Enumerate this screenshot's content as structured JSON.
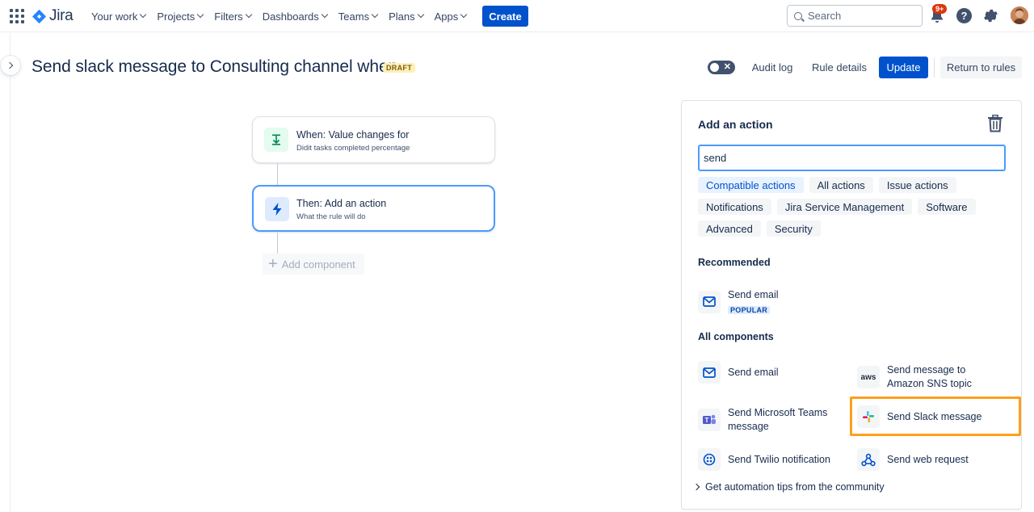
{
  "topnav": {
    "logo": "Jira",
    "items": [
      "Your work",
      "Projects",
      "Filters",
      "Dashboards",
      "Teams",
      "Plans",
      "Apps"
    ],
    "create_label": "Create",
    "search_placeholder": "Search",
    "notification_badge": "9+",
    "help_glyph": "?"
  },
  "header": {
    "title": "Send slack message to Consulting channel when",
    "status": "DRAFT",
    "toggle_glyph": "✕",
    "audit_label": "Audit log",
    "details_label": "Rule details",
    "update_label": "Update",
    "return_label": "Return to rules"
  },
  "flow": {
    "trigger": {
      "title": "When: Value changes for",
      "subtitle": "Didit tasks completed percentage"
    },
    "action": {
      "title": "Then: Add an action",
      "subtitle": "What the rule will do"
    },
    "add_component": "Add component"
  },
  "panel": {
    "title": "Add an action",
    "search_value": "send",
    "filters": [
      [
        "Compatible actions",
        "All actions",
        "Issue actions"
      ],
      [
        "Notifications",
        "Jira Service Management",
        "Software"
      ],
      [
        "Advanced",
        "Security"
      ]
    ],
    "recommended_heading": "Recommended",
    "recommended": {
      "label": "Send email",
      "tag": "POPULAR"
    },
    "all_heading": "All components",
    "components": {
      "email": "Send email",
      "sns": "Send message to Amazon SNS topic",
      "teams": "Send Microsoft Teams message",
      "slack": "Send Slack message",
      "twilio": "Send Twilio notification",
      "web": "Send web request"
    },
    "aws_text": "aws",
    "tips": "Get automation tips from the community"
  },
  "colors": {
    "brand": "#0052cc",
    "highlight": "#ff9f1a",
    "draft_bg": "#fff0b3",
    "focus": "#4c9aff"
  }
}
